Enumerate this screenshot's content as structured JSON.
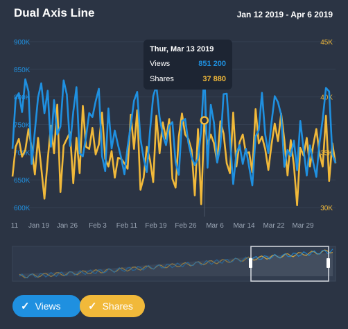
{
  "title": "Dual Axis Line",
  "date_range": "Jan 12 2019 - Apr 6 2019",
  "colors": {
    "views": "#1f90e0",
    "shares": "#f1b93a",
    "background": "#2b3444",
    "tooltip_bg": "#1d2533"
  },
  "tooltip": {
    "date": "Thur, Mar 13 2019",
    "rows": [
      {
        "label": "Views",
        "value": "851 200",
        "color": "#1f90e0"
      },
      {
        "label": "Shares",
        "value": "37 880",
        "color": "#f1b93a"
      }
    ]
  },
  "legend": [
    {
      "label": "Views",
      "icon": "check-icon",
      "color": "#1f90e0"
    },
    {
      "label": "Shares",
      "icon": "check-icon",
      "color": "#f1b93a"
    }
  ],
  "chart_data": {
    "type": "line",
    "x_start": "2019-01-12",
    "x_tick_labels": [
      "11",
      "Jan 19",
      "Jan 26",
      "Feb 3",
      "Feb 11",
      "Feb 19",
      "Feb 26",
      "Mar 6",
      "Mar 14",
      "Mar 22",
      "Mar 29"
    ],
    "y_left": {
      "ticks": [
        "600K",
        "650K",
        "700K",
        "750K",
        "800K",
        "850K",
        "900K"
      ],
      "range": [
        600000,
        900000
      ]
    },
    "y_right": {
      "ticks": [
        "30K",
        "35K",
        "40K",
        "45K"
      ],
      "range": [
        30000,
        45000
      ]
    },
    "highlight_date": "2019-03-13",
    "series": [
      {
        "name": "Views",
        "axis": "left",
        "color": "#1f90e0",
        "values": [
          706200,
          797500,
          806800,
          772600,
          831800,
          810000,
          678700,
          738500,
          799100,
          824700,
          770600,
          811300,
          709800,
          794300,
          732000,
          746700,
          830000,
          804300,
          711300,
          773200,
          817800,
          697900,
          692600,
          728100,
          770900,
          763600,
          792200,
          814800,
          693100,
          665700,
          779200,
          706700,
          739300,
          712800,
          689500,
          660200,
          710100,
          749300,
          793100,
          809100,
          724300,
          688900,
          664300,
          738700,
          801500,
          820300,
          763600,
          731100,
          712900,
          747800,
          754500,
          681600,
          659200,
          756300,
          760200,
          716800,
          691000,
          676900,
          688600,
          739200,
          847200,
          672000,
          785800,
          753000,
          681200,
          709800,
          805000,
          805800,
          723700,
          642600,
          697700,
          712900,
          678800,
          706300,
          673200,
          640100,
          728400,
          740100,
          807500,
          733000,
          698400,
          754200,
          801400,
          790400,
          767600,
          673600,
          704100,
          693300,
          720900,
          667500,
          756500,
          705600,
          657700,
          712200,
          682400,
          655600,
          717300,
          759700,
          816300,
          810000,
          696400,
          680200
        ]
      },
      {
        "name": "Shares",
        "axis": "right",
        "color": "#f1b93a",
        "values": [
          32800,
          35500,
          36200,
          34600,
          35200,
          37100,
          35400,
          33000,
          36300,
          33600,
          30800,
          34300,
          37400,
          34900,
          39300,
          31400,
          35600,
          36200,
          36800,
          32200,
          36300,
          33100,
          39200,
          35500,
          35300,
          37200,
          34800,
          35700,
          38600,
          34400,
          33700,
          35100,
          32700,
          34500,
          34400,
          34000,
          33500,
          38400,
          35300,
          38800,
          31600,
          32700,
          35500,
          34300,
          32300,
          38300,
          34900,
          37700,
          36200,
          38000,
          32600,
          31800,
          36400,
          38500,
          36600,
          36200,
          35200,
          31100,
          37100,
          30300,
          37880,
          35700,
          36600,
          35800,
          34100,
          37800,
          36700,
          34000,
          33100,
          38600,
          33700,
          35900,
          36600,
          34900,
          35000,
          33200,
          38900,
          35800,
          36400,
          35300,
          33400,
          35700,
          37600,
          36000,
          38500,
          36100,
          32900,
          36100,
          33800,
          30200,
          35400,
          34700,
          36300,
          33700,
          35600,
          37100,
          34900,
          33700,
          38300,
          32400,
          35800,
          34000
        ]
      }
    ],
    "navigator": {
      "window_start": "2019-01-12",
      "window_end": "2019-04-06",
      "views_trend": [
        660000,
        665000,
        670000,
        675000,
        680000,
        690000,
        700000,
        705000,
        715000,
        725000,
        735000,
        745000,
        750000,
        760000,
        770000,
        775000,
        785000,
        795000,
        800000,
        810000,
        815000,
        820000,
        825000,
        830000,
        835000
      ]
    }
  }
}
